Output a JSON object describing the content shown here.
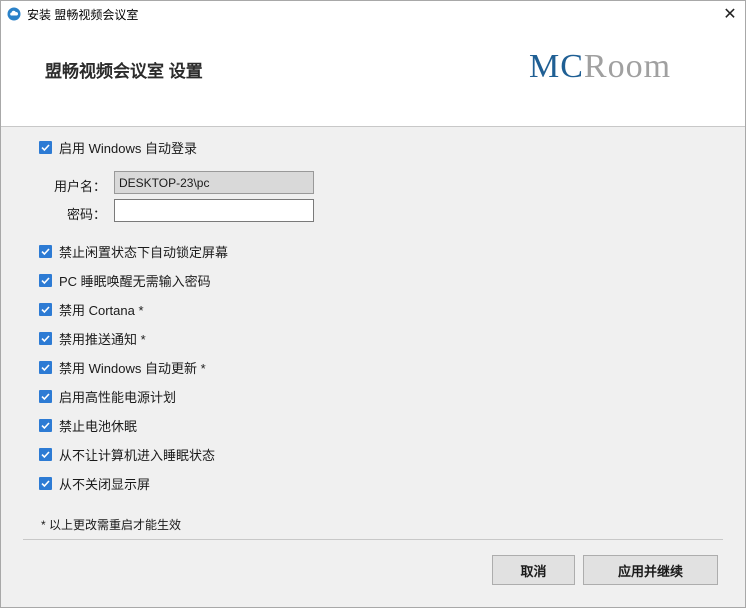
{
  "window": {
    "title": "安装 盟畅视频会议室",
    "close_glyph": "✕"
  },
  "header": {
    "title": "盟畅视频会议室 设置",
    "logo_mc": "MC",
    "logo_room": "Room",
    "logo_colors": {
      "mc": "#1f5f94",
      "room": "#a0a0a0"
    }
  },
  "options": {
    "auto_login": {
      "label": "启用 Windows 自动登录",
      "checked": true
    },
    "username": {
      "label": "用户名：",
      "value": "DESKTOP-23\\pc"
    },
    "password": {
      "label": "密码：",
      "value": ""
    },
    "items": [
      {
        "label": "禁止闲置状态下自动锁定屏幕",
        "checked": true
      },
      {
        "label": "PC 睡眠唤醒无需输入密码",
        "checked": true
      },
      {
        "label": "禁用 Cortana *",
        "checked": true
      },
      {
        "label": "禁用推送通知 *",
        "checked": true
      },
      {
        "label": "禁用 Windows 自动更新 *",
        "checked": true
      },
      {
        "label": "启用高性能电源计划",
        "checked": true
      },
      {
        "label": "禁止电池休眠",
        "checked": true
      },
      {
        "label": "从不让计算机进入睡眠状态",
        "checked": true
      },
      {
        "label": "从不关闭显示屏",
        "checked": true
      }
    ],
    "note": "* 以上更改需重启才能生效"
  },
  "buttons": {
    "cancel": "取消",
    "apply": "应用并继续"
  },
  "colors": {
    "checkbox": "#2d7bd4"
  }
}
